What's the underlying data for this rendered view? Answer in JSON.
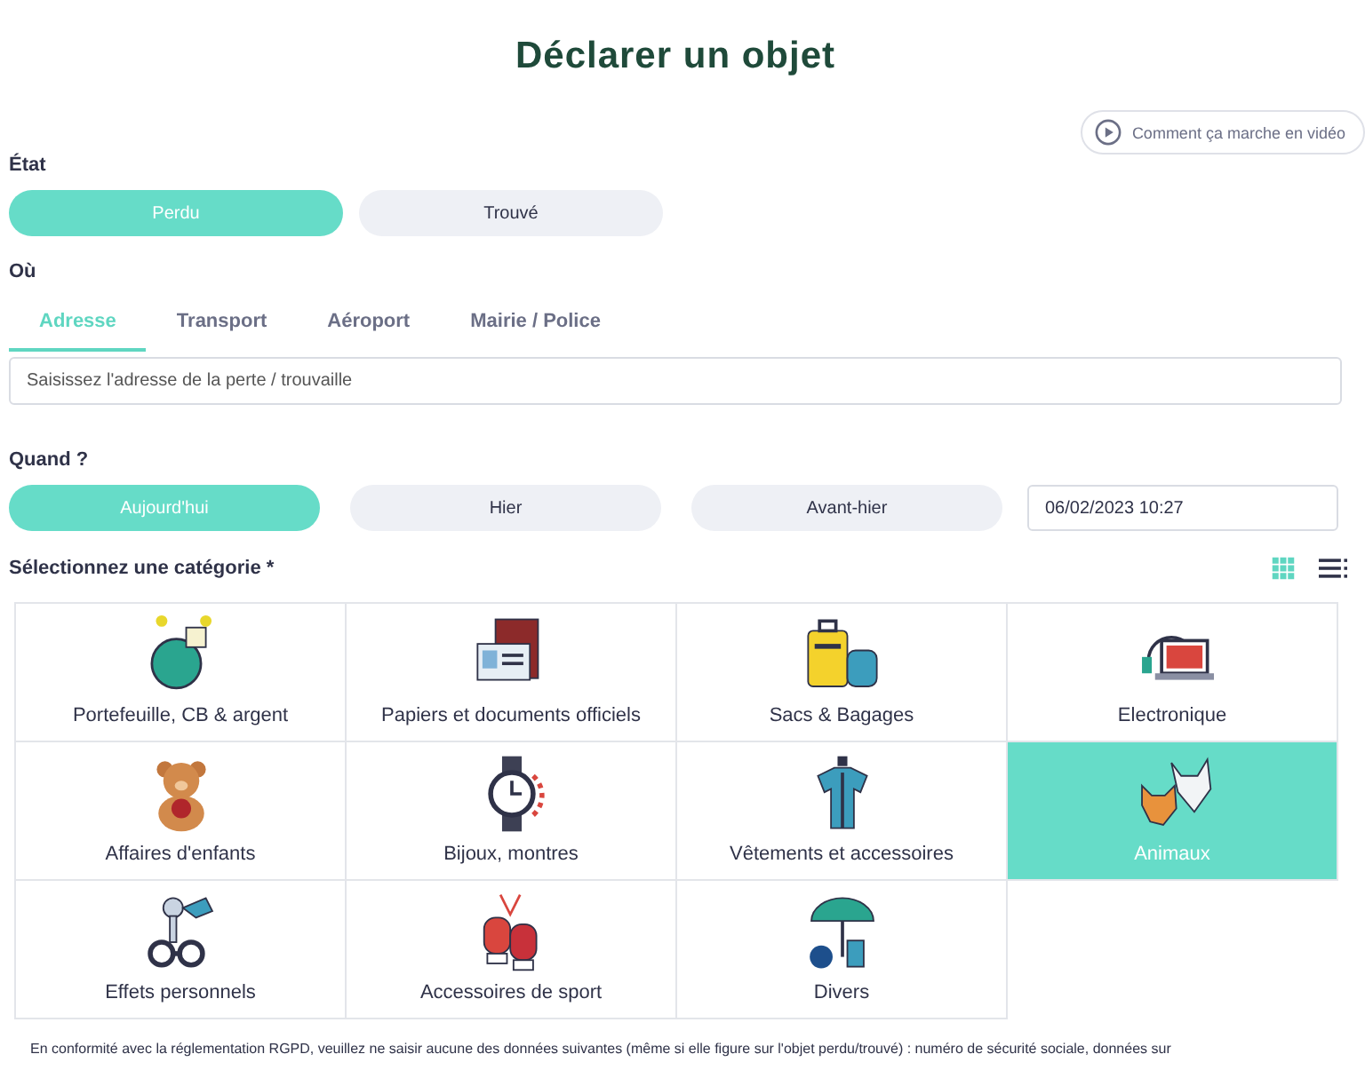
{
  "title": "Déclarer un objet",
  "video_button": {
    "label": "Comment ça marche en vidéo"
  },
  "etat": {
    "label": "État",
    "options": [
      {
        "label": "Perdu",
        "selected": true
      },
      {
        "label": "Trouvé",
        "selected": false
      }
    ]
  },
  "ou": {
    "label": "Où",
    "tabs": [
      {
        "label": "Adresse",
        "selected": true
      },
      {
        "label": "Transport",
        "selected": false
      },
      {
        "label": "Aéroport",
        "selected": false
      },
      {
        "label": "Mairie / Police",
        "selected": false
      }
    ],
    "address_field": {
      "placeholder": "Saisissez l'adresse de la perte / trouvaille"
    }
  },
  "quand": {
    "label": "Quand ?",
    "options": [
      {
        "label": "Aujourd'hui",
        "selected": true
      },
      {
        "label": "Hier",
        "selected": false
      },
      {
        "label": "Avant-hier",
        "selected": false
      }
    ],
    "datetime_field": {
      "value": "06/02/2023 10:27"
    }
  },
  "categories": {
    "label": "Sélectionnez une catégorie *",
    "views": [
      {
        "kind": "grid",
        "selected": true
      },
      {
        "kind": "list",
        "selected": false
      }
    ],
    "items": [
      {
        "label": "Portefeuille, CB & argent",
        "kind": "wallet",
        "selected": false
      },
      {
        "label": "Papiers et documents officiels",
        "kind": "documents",
        "selected": false
      },
      {
        "label": "Sacs & Bagages",
        "kind": "luggage",
        "selected": false
      },
      {
        "label": "Electronique",
        "kind": "electronics",
        "selected": false
      },
      {
        "label": "Affaires d'enfants",
        "kind": "teddy",
        "selected": false
      },
      {
        "label": "Bijoux, montres",
        "kind": "watch",
        "selected": false
      },
      {
        "label": "Vêtements et accessoires",
        "kind": "clothing",
        "selected": false
      },
      {
        "label": "Animaux",
        "kind": "pets",
        "selected": true
      },
      {
        "label": "Effets personnels",
        "kind": "keys",
        "selected": false
      },
      {
        "label": "Accessoires de sport",
        "kind": "gloves",
        "selected": false
      },
      {
        "label": "Divers",
        "kind": "umbrella",
        "selected": false
      }
    ]
  },
  "notice": "En conformité avec la réglementation RGPD, veuillez ne saisir aucune des données suivantes (même si elle figure sur l'objet perdu/trouvé) : numéro de sécurité sociale, données sur"
}
